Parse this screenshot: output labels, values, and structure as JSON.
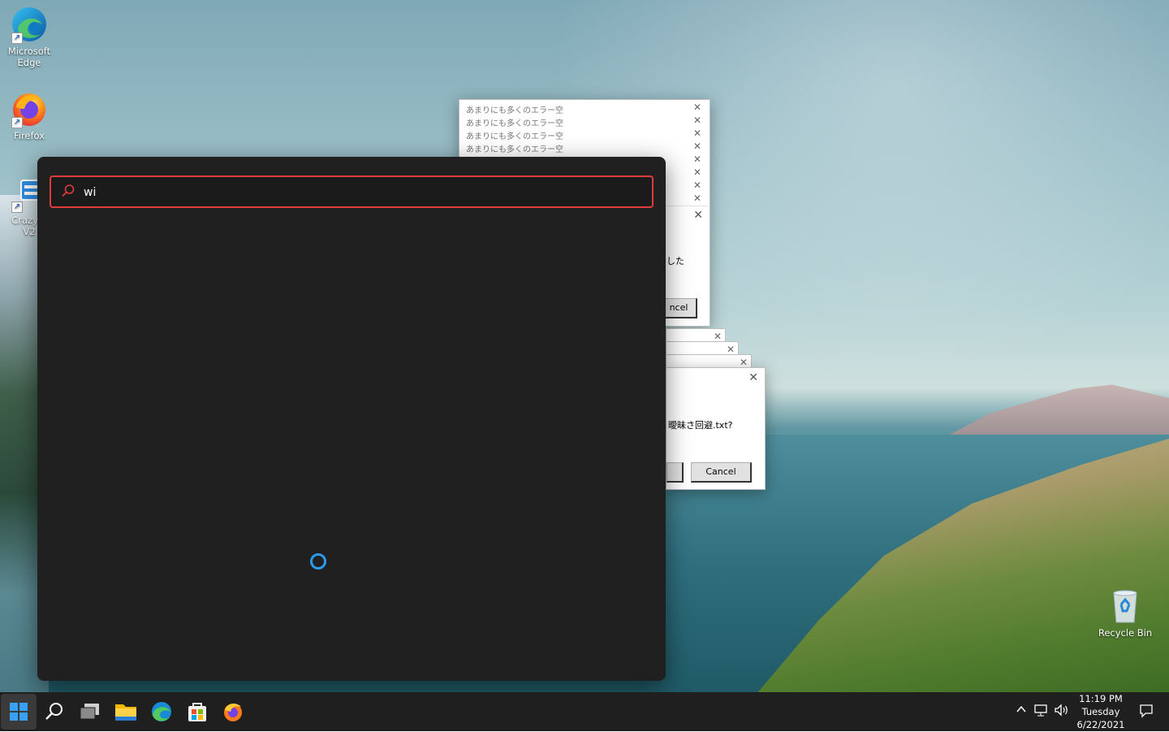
{
  "desktop": {
    "icons": [
      {
        "label_line1": "Microsoft",
        "label_line2": "Edge"
      },
      {
        "label_line1": "Firefox",
        "label_line2": ""
      },
      {
        "label_line1": "Crazy E",
        "label_line2": "V2"
      },
      {
        "label_line1": "Recycle Bin",
        "label_line2": ""
      }
    ]
  },
  "dialogs": {
    "stack_title": "あまりにも多くのエラー空",
    "upper_box_text_fragment": "した",
    "upper_box_button_fragment": "ncel",
    "lower_box_text_fragment": "曖昧さ回避.txt?",
    "lower_box_cancel_label": "Cancel"
  },
  "search": {
    "query": "wi",
    "loading": true
  },
  "taskbar": {
    "apps": [
      "Start",
      "Search",
      "Task View",
      "File Explorer",
      "Microsoft Edge",
      "Microsoft Store",
      "Firefox"
    ],
    "clock": {
      "time": "11:19 PM",
      "day": "Tuesday",
      "date": "6/22/2021"
    }
  },
  "colors": {
    "accent": "#2b9af3",
    "search_border": "#e03b3b",
    "flyout_bg": "#202020",
    "taskbar_bg": "#1f1f1f"
  }
}
